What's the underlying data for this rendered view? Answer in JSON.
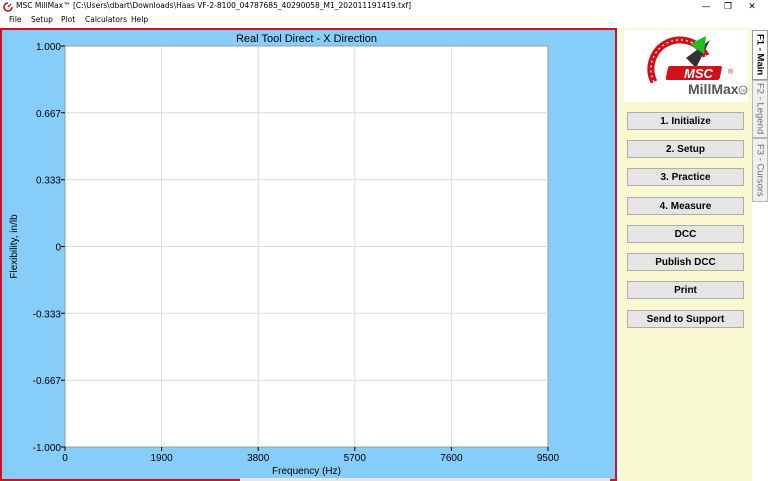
{
  "window": {
    "title": "MSC MillMax™ [C:\\Users\\dbart\\Downloads\\Haas VF-2-8100_04787685_40290058_M1_202011191419.txf]",
    "controls": [
      "—",
      "❐",
      "✕"
    ]
  },
  "menu": [
    "File",
    "Setup",
    "Plot",
    "Calculators",
    "Help"
  ],
  "logo": {
    "brand": "MSC",
    "product": "MillMax",
    "registered": "®",
    "trademark": "TM"
  },
  "buttons": [
    "1. Initialize",
    "2. Setup",
    "3. Practice",
    "4. Measure",
    "DCC",
    "Publish DCC",
    "Print",
    "Send to Support"
  ],
  "tabs": [
    {
      "label": "F1 - Main",
      "active": true
    },
    {
      "label": "F2 - Legend",
      "active": false
    },
    {
      "label": "F3 - Cursors",
      "active": false
    }
  ],
  "colors": {
    "plot_background": "#87cdfa",
    "panel_background": "#fafad2",
    "plot_border": "#d0101a",
    "logo_red": "#d0101a",
    "logo_green": "#20c020"
  },
  "chart_data": {
    "type": "line",
    "title": "Real Tool Direct - X Direction",
    "xlabel": "Frequency (Hz)",
    "ylabel": "Flexibility, in/lb",
    "xlim": [
      0,
      9500
    ],
    "ylim": [
      -1.0,
      1.0
    ],
    "xticks": [
      0,
      1900,
      3800,
      5700,
      7600,
      9500
    ],
    "xtick_labels": [
      "0",
      "1900",
      "3800",
      "5700",
      "7600",
      "9500"
    ],
    "yticks": [
      1.0,
      0.667,
      0.333,
      0,
      -0.333,
      -0.667,
      -1.0
    ],
    "ytick_labels": [
      "1.000",
      "0.667",
      "0.333",
      "0",
      "-0.333",
      "-0.667",
      "-1.000"
    ],
    "grid": true,
    "series": []
  }
}
